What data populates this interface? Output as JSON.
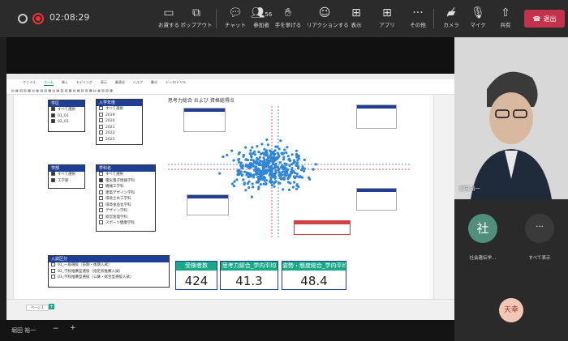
{
  "toolbar": {
    "timer": "02:08:29",
    "buttons": [
      {
        "label": "お貸する",
        "icon": "screen-icon"
      },
      {
        "label": "ポップアウト",
        "icon": "popout-icon"
      },
      {
        "label": "チャット",
        "icon": "chat-icon"
      },
      {
        "label": "参加者",
        "icon": "people-icon",
        "count": "56"
      },
      {
        "label": "手を挙げる",
        "icon": "hand-icon"
      },
      {
        "label": "リアクションする",
        "icon": "smile-icon"
      },
      {
        "label": "表示",
        "icon": "grid-icon"
      },
      {
        "label": "アプリ",
        "icon": "apps-icon"
      },
      {
        "label": "その他",
        "icon": "more-icon"
      },
      {
        "label": "カメラ",
        "icon": "camera-off-icon"
      },
      {
        "label": "マイク",
        "icon": "mic-off-icon"
      },
      {
        "label": "共有",
        "icon": "share-icon"
      }
    ],
    "leave_label": "退出"
  },
  "pbi": {
    "tabs": [
      "ファイル",
      "ホーム",
      "挿入",
      "モデリング",
      "表示",
      "最適化",
      "ヘルプ",
      "書式",
      "データ/ドリル"
    ],
    "active_tab": "ホーム",
    "chart_title": "思考力総合 および 資格総得点",
    "page_tab": "ページ 1"
  },
  "slicers": {
    "course": {
      "title": "学区",
      "items": [
        {
          "label": "すべて選択",
          "on": true
        },
        {
          "label": "01_01",
          "on": true
        },
        {
          "label": "02_01",
          "on": true
        }
      ]
    },
    "year": {
      "title": "入学年度",
      "items": [
        {
          "label": "すべて選択",
          "on": false
        },
        {
          "label": "2019",
          "on": false
        },
        {
          "label": "2020",
          "on": false
        },
        {
          "label": "2021",
          "on": false
        },
        {
          "label": "2022",
          "on": false
        },
        {
          "label": "2023",
          "on": false
        }
      ]
    },
    "faculty": {
      "title": "学部",
      "items": [
        {
          "label": "すべて選択",
          "on": true
        },
        {
          "label": "工学部",
          "on": true
        }
      ]
    },
    "dept": {
      "title": "学科名",
      "items": [
        {
          "label": "すべて選択",
          "on": false
        },
        {
          "label": "電気電子情報学科",
          "on": true
        },
        {
          "label": "機械工学科",
          "on": false
        },
        {
          "label": "建築デザイン学科",
          "on": false
        },
        {
          "label": "環境土木工学科",
          "on": false
        },
        {
          "label": "環境食品化学科",
          "on": false
        },
        {
          "label": "デザイン学科",
          "on": false
        },
        {
          "label": "経営管理学科",
          "on": false
        },
        {
          "label": "スポーツ健康学科",
          "on": false
        }
      ]
    },
    "entry": {
      "title": "入試区分",
      "items": [
        {
          "label": "01_一般選抜（前期・後期入試）",
          "on": false
        },
        {
          "label": "02_学校推薦型選抜（指定校推薦入試）",
          "on": false
        },
        {
          "label": "03_学校推薦型選抜（公募・総合型選抜入試）",
          "on": false
        }
      ]
    }
  },
  "cards": [
    {
      "header": "受検者数",
      "value": "424"
    },
    {
      "header": "思考力総合_学内平均",
      "value": "41.3"
    },
    {
      "header": "姿勢・態度総合_学内平均",
      "value": "48.4"
    }
  ],
  "participants": {
    "speaker_name": "堀田 裕一",
    "tile1_name": "社会遺伝学…",
    "tile1_initial": "社",
    "show_all": "すべて表示",
    "tile2_initial": "天幸"
  },
  "bottom_name": "堀田 裕一",
  "colors": {
    "accent_blue": "#1f3f94",
    "accent_green": "#1aa88a",
    "leave": "#c4314b"
  }
}
